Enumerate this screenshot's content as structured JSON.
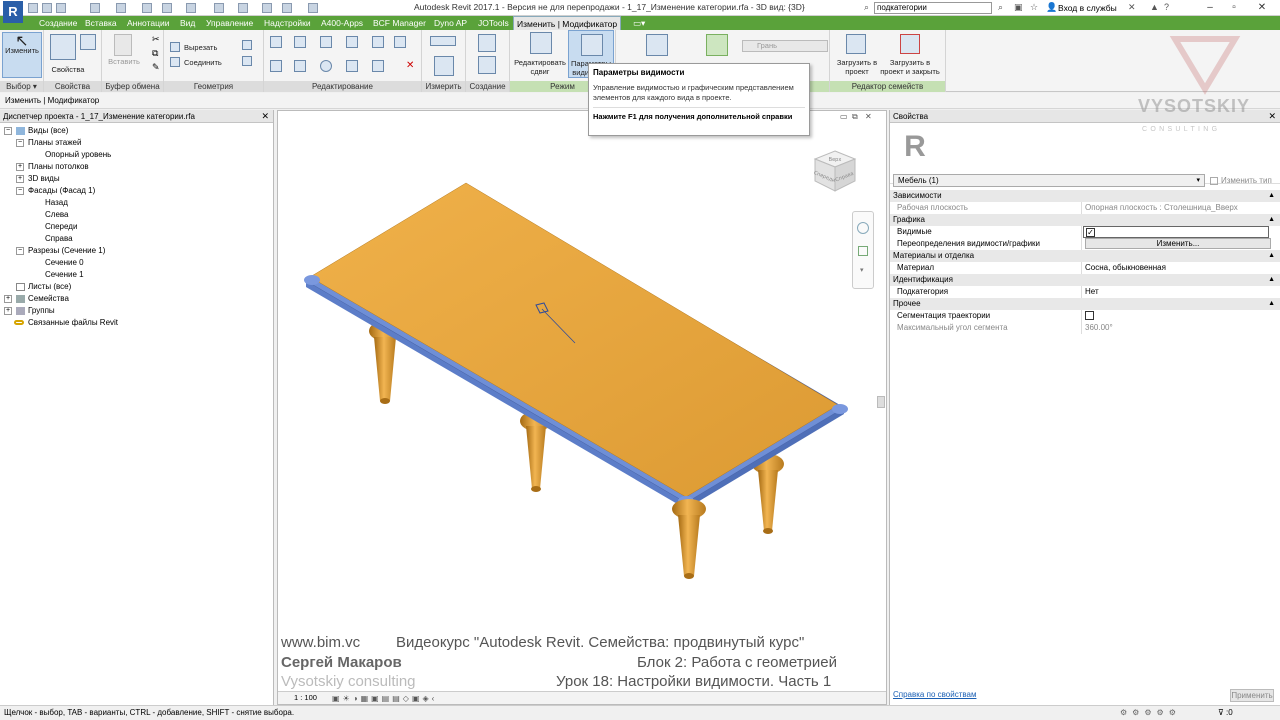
{
  "window": {
    "app_logo": "R",
    "title": "Autodesk Revit 2017.1 - Версия не для перепродажи -    1_17_Изменение категории.rfa - 3D вид: {3D}",
    "search_value": "подкатегории",
    "signin": "Вход в службы"
  },
  "tabs": [
    {
      "label": "Создание"
    },
    {
      "label": "Вставка"
    },
    {
      "label": "Аннотации"
    },
    {
      "label": "Вид"
    },
    {
      "label": "Управление"
    },
    {
      "label": "Надстройки"
    },
    {
      "label": "A400-Apps"
    },
    {
      "label": "BCF Manager"
    },
    {
      "label": "Dyno AP"
    },
    {
      "label": "JOTools"
    },
    {
      "label": "Изменить | Модификатор"
    }
  ],
  "ribbon": {
    "modify_label": "Изменить",
    "properties_label": "Свойства",
    "paste_label": "Вставить",
    "cut_label": "Вырезать",
    "join_label": "Соединить",
    "edit_sweep_label": "Редактировать сдвиг",
    "visibility_label": "Параметры видимости",
    "load_project_label": "Загрузить в проект",
    "load_close_label": "Загрузить в проект и закрыть",
    "face_label": "Грань",
    "panels": {
      "select": "Выбор ▾",
      "properties": "Свойства",
      "clipboard": "Буфер обмена",
      "geometry": "Геометрия",
      "modify": "Редактирование",
      "measure": "Измерить",
      "create": "Создание",
      "mode": "Режим",
      "family_editor": "Редактор семейств"
    }
  },
  "modifier_bar": "Изменить | Модификатор",
  "tooltip": {
    "title": "Параметры видимости",
    "description": "Управление видимостью и графическим представлением элементов для каждого вида в проекте.",
    "help": "Нажмите F1 для получения дополнительной справки"
  },
  "browser": {
    "title": "Диспетчер проекта - 1_17_Изменение категории.rfa",
    "items": [
      {
        "label": "Виды (все)",
        "toggle": "−"
      },
      {
        "label": "Планы этажей",
        "toggle": "−"
      },
      {
        "label": "Опорный уровень",
        "toggle": ""
      },
      {
        "label": "Планы потолков",
        "toggle": "+"
      },
      {
        "label": "3D виды",
        "toggle": "+"
      },
      {
        "label": "Фасады (Фасад 1)",
        "toggle": "−"
      },
      {
        "label": "Назад",
        "toggle": ""
      },
      {
        "label": "Слева",
        "toggle": ""
      },
      {
        "label": "Спереди",
        "toggle": ""
      },
      {
        "label": "Справа",
        "toggle": ""
      },
      {
        "label": "Разрезы (Сечение 1)",
        "toggle": "−"
      },
      {
        "label": "Сечение 0",
        "toggle": ""
      },
      {
        "label": "Сечение 1",
        "toggle": ""
      },
      {
        "label": "Листы (все)",
        "toggle": ""
      },
      {
        "label": "Семейства",
        "toggle": "+"
      },
      {
        "label": "Группы",
        "toggle": "+"
      },
      {
        "label": "Связанные файлы Revit",
        "toggle": ""
      }
    ]
  },
  "viewport": {
    "scale": "1 : 100",
    "overlay": {
      "site": "www.bim.vc",
      "course": "Видеокурс \"Autodesk Revit. Семейства: продвинутый курс\"",
      "author": "Сергей Макаров",
      "block": "Блок 2: Работа с геометрией",
      "company": "Vysotskiy consulting",
      "lesson": "Урок 18: Настройки видимости. Часть 1"
    },
    "viewcube": {
      "left_face": "Спереди",
      "right_face": "Справа",
      "top_face": "Верх"
    },
    "colors": {
      "tabletop": "#e8a23a",
      "edge": "#6f8fd6",
      "legs": "#d99a35"
    }
  },
  "properties": {
    "title": "Свойства",
    "type_logo": "R",
    "type_value": "Мебель (1)",
    "edit_type": "Изменить тип",
    "groups": [
      {
        "name": "Зависимости",
        "rows": [
          {
            "name": "Рабочая плоскость",
            "value": "Опорная плоскость : Столешница_Вверх"
          }
        ]
      },
      {
        "name": "Графика",
        "rows": [
          {
            "name": "Видимые",
            "value": ""
          },
          {
            "name": "Переопределения видимости/графики",
            "value": "Изменить..."
          }
        ]
      },
      {
        "name": "Материалы и отделка",
        "rows": [
          {
            "name": "Материал",
            "value": "Сосна, обыкновенная"
          }
        ]
      },
      {
        "name": "Идентификация",
        "rows": [
          {
            "name": "Подкатегория",
            "value": "Нет"
          }
        ]
      },
      {
        "name": "Прочее",
        "rows": [
          {
            "name": "Сегментация траектории",
            "value": ""
          },
          {
            "name": "Максимальный угол сегмента",
            "value": "360.00°"
          }
        ]
      }
    ],
    "help_link": "Справка по свойствам",
    "apply": "Применить"
  },
  "statusbar": {
    "text": "Щелчок - выбор, TAB - варианты, CTRL - добавление, SHIFT - снятие выбора.",
    "filter_count": ":0"
  },
  "watermark": {
    "brand": "VYSOTSKIY",
    "sub": "CONSULTING"
  }
}
